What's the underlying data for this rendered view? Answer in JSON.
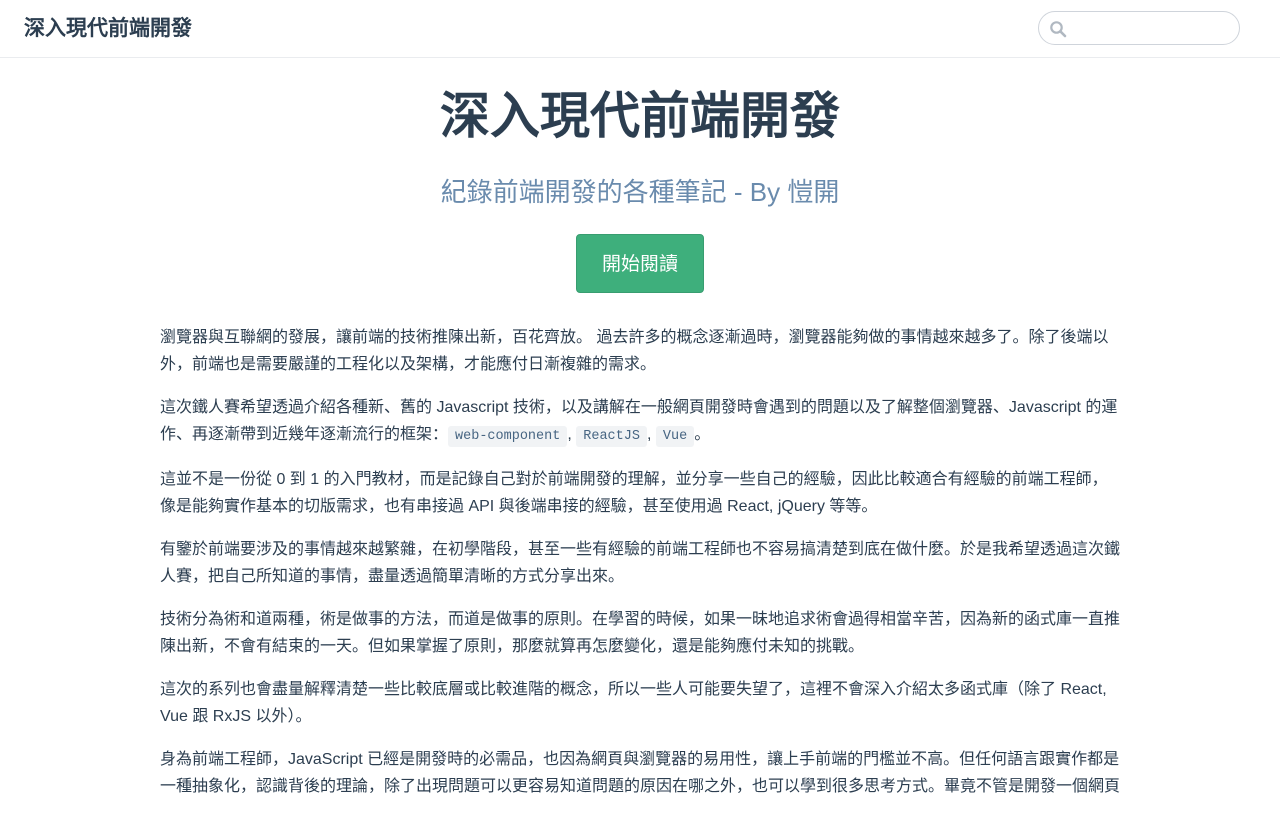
{
  "navbar": {
    "site_name": "深入現代前端開發",
    "search": {
      "value": "",
      "placeholder": ""
    }
  },
  "hero": {
    "title": "深入現代前端開發",
    "description": "紀錄前端開發的各種筆記 - By 愷開",
    "action_label": "開始閱讀"
  },
  "content": {
    "p1": "瀏覽器與互聯網的發展，讓前端的技術推陳出新，百花齊放。 過去許多的概念逐漸過時，瀏覽器能夠做的事情越來越多了。除了後端以外，前端也是需要嚴謹的工程化以及架構，才能應付日漸複雜的需求。",
    "p2": {
      "text": "這次鐵人賽希望透過介紹各種新、舊的 Javascript 技術，以及講解在一般網頁開發時會遇到的問題以及了解整個瀏覽器、Javascript 的運作、再逐漸帶到近幾年逐漸流行的框架：",
      "code1": "web-component",
      "sep1": ",",
      "code2": "ReactJS",
      "sep2": ",",
      "code3": "Vue",
      "end": "。"
    },
    "p3": "這並不是一份從 0 到 1 的入門教材，而是記錄自己對於前端開發的理解，並分享一些自己的經驗，因此比較適合有經驗的前端工程師，像是能夠實作基本的切版需求，也有串接過 API 與後端串接的經驗，甚至使用過 React, jQuery 等等。",
    "p4": "有鑒於前端要涉及的事情越來越繁雜，在初學階段，甚至一些有經驗的前端工程師也不容易搞清楚到底在做什麼。於是我希望透過這次鐵人賽，把自己所知道的事情，盡量透過簡單清晰的方式分享出來。",
    "p5": "技術分為術和道兩種，術是做事的方法，而道是做事的原則。在學習的時候，如果一昧地追求術會過得相當辛苦，因為新的函式庫一直推陳出新，不會有結束的一天。但如果掌握了原則，那麼就算再怎麼變化，還是能夠應付未知的挑戰。",
    "p6": "這次的系列也會盡量解釋清楚一些比較底層或比較進階的概念，所以一些人可能要失望了，這裡不會深入介紹太多函式庫（除了 React, Vue 跟 RxJS 以外）。",
    "p7": "身為前端工程師，JavaScript 已經是開發時的必需品，也因為網頁與瀏覽器的易用性，讓上手前端的門檻並不高。但任何語言跟實作都是一種抽象化，認識背後的理論，除了出現問題可以更容易知道問題的原因在哪之外，也可以學到很多思考方式。畢竟不管是開發一個網頁"
  }
}
